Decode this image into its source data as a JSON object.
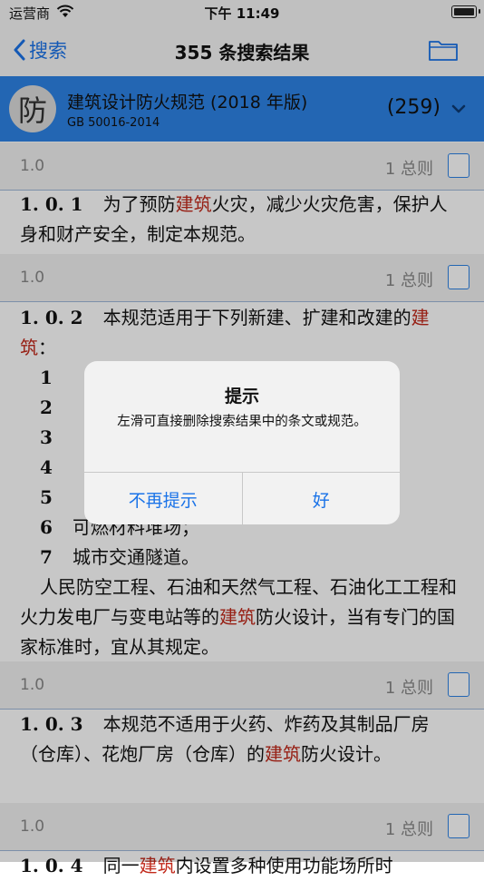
{
  "status_bar": {
    "carrier": "运营商",
    "time": "下午 11:49"
  },
  "nav": {
    "back_label": "搜索",
    "title": "355 条搜索结果"
  },
  "book": {
    "seal_char": "防",
    "name": "建筑设计防火规范 (2018 年版)",
    "code": "GB 50016-2014",
    "count": "(259)"
  },
  "results": [
    {
      "section": "1.0",
      "chapter": "1 总则",
      "clause_no": "1. 0. 1",
      "text_a": "为了预防",
      "hl": "建筑",
      "text_b": "火灾，减少火灾危害，保护人身和财产安全，制定本规范。"
    },
    {
      "section": "1.0",
      "chapter": "1 总则",
      "clause_no": "1. 0. 2",
      "text_a": "本规范适用于下列新建、扩建和改建的",
      "hl": "建筑",
      "text_b": "：",
      "items": [
        {
          "n": "1",
          "t": ""
        },
        {
          "n": "2",
          "t": ""
        },
        {
          "n": "3",
          "t": ""
        },
        {
          "n": "4",
          "t": ""
        },
        {
          "n": "5",
          "t": ""
        },
        {
          "n": "6",
          "t": "可燃材料堆场；"
        },
        {
          "n": "7",
          "t": "城市交通隧道。"
        }
      ],
      "tail_a": "人民防空工程、石油和天然气工程、石油化工工程和火力发电厂与变电站等的",
      "tail_hl": "建筑",
      "tail_b": "防火设计，当有专门的国家标准时，宜从其规定。"
    },
    {
      "section": "1.0",
      "chapter": "1 总则",
      "clause_no": "1. 0. 3",
      "text_a": "本规范不适用于火药、炸药及其制品厂房（仓库）、花炮厂房（仓库）的",
      "hl": "建筑",
      "text_b": "防火设计。"
    },
    {
      "section": "1.0",
      "chapter": "1 总则",
      "clause_no": "1. 0. 4",
      "text_a": "同一",
      "hl": "建筑",
      "text_b": "内设置多种使用功能场所时"
    }
  ],
  "alert": {
    "title": "提示",
    "message": "左滑可直接删除搜索结果中的条文或规范。",
    "btn_left": "不再提示",
    "btn_right": "好"
  },
  "colors": {
    "accent": "#1a73e8",
    "book_bar": "#2d83e6",
    "highlight": "#c22a1c"
  }
}
